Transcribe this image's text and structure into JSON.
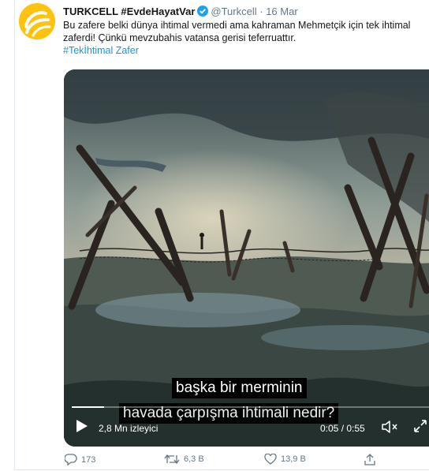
{
  "tweet": {
    "author_name": "TURKCELL #EvdeHayatVar",
    "handle": "@Turkcell",
    "separator": "·",
    "date": "16 Mar",
    "text": "Bu zafere belki dünya ihtimal vermedi ama kahraman Mehmetçik için tek ihtimal zaferdi! Çünkü mevzubahis vatansa gerisi teferruattır.",
    "hashtag": "#Tekİhtimal Zafer",
    "brand_color": "#ffc20e",
    "link_color": "#1b95e0"
  },
  "video": {
    "caption_line_1": "başka bir merminin",
    "caption_line_2": "havada çarpışma ihtimali nedir?",
    "views": "2,8 Mn izleyici",
    "time": "0:05 / 0:55",
    "progress": 0.09,
    "icons": [
      "play-icon",
      "volume-icon",
      "fullscreen-icon"
    ]
  },
  "actions": {
    "replies": "173",
    "retweets": "6,3 B",
    "likes": "13,9 B",
    "icons": [
      "reply-icon",
      "retweet-icon",
      "like-icon",
      "share-icon"
    ]
  }
}
